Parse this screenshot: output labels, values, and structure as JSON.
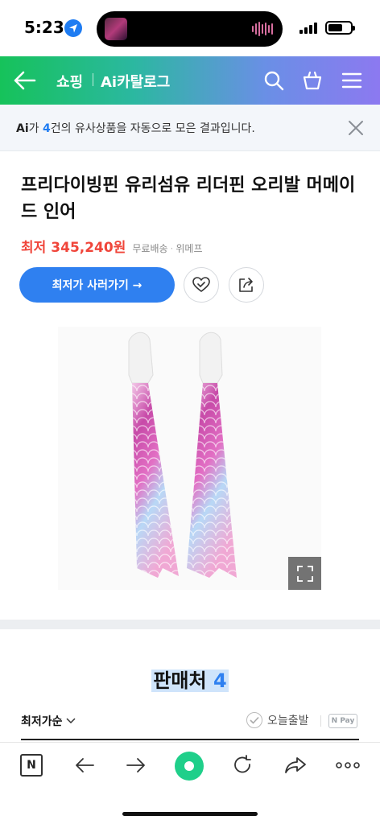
{
  "status_bar": {
    "time": "5:23"
  },
  "header": {
    "shop_label": "쇼핑",
    "catalog_label": "Ai카탈로그",
    "gradient_colors": [
      "#16c25a",
      "#8c79f0"
    ]
  },
  "ai_banner": {
    "ai_mark": "Ai",
    "text_prefix": "가 ",
    "count": "4",
    "text_suffix": "건의 유사상품을 자동으로 모은 결과입니다."
  },
  "product": {
    "title": "프리다이빙핀 유리섬유 리더핀 오리발 머메이드 인어",
    "price_label": "최저",
    "price_value": "345,240원",
    "shipping": "무료배송",
    "seller": "위메프",
    "buy_button": "최저가 사러가기 →",
    "accent_color": "#f0453a"
  },
  "sellers": {
    "title": "판매처",
    "count": "4",
    "sort_label": "최저가순",
    "today_label": "오늘출발",
    "npay_label": "N Pay"
  },
  "toolbar": {
    "n_label": "N"
  }
}
